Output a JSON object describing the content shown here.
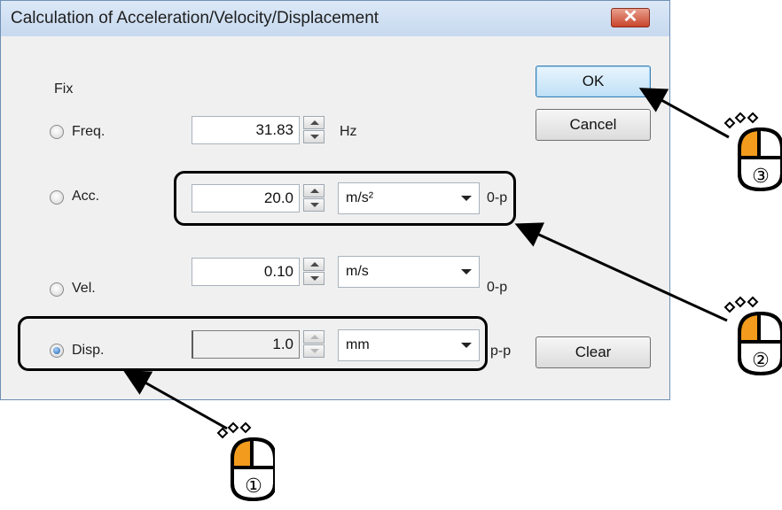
{
  "window": {
    "title": "Calculation of Acceleration/Velocity/Displacement",
    "close_symbol": "✕"
  },
  "fix_label": "Fix",
  "rows": {
    "freq": {
      "label": "Freq.",
      "value": "31.83",
      "unit": "Hz",
      "checked": false
    },
    "acc": {
      "label": "Acc.",
      "value": "20.0",
      "unit": "m/s²",
      "suffix": "0-p",
      "checked": false
    },
    "vel": {
      "label": "Vel.",
      "value": "0.10",
      "unit": "m/s",
      "suffix": "0-p",
      "checked": false
    },
    "disp": {
      "label": "Disp.",
      "value": "1.0",
      "unit": "mm",
      "suffix": "p-p",
      "checked": true
    }
  },
  "buttons": {
    "ok": "OK",
    "cancel": "Cancel",
    "clear": "Clear"
  },
  "callouts": {
    "step1": "①",
    "step2": "②",
    "step3": "③"
  },
  "colors": {
    "mouse_accent": "#f29b1d",
    "callout": "#000000"
  }
}
